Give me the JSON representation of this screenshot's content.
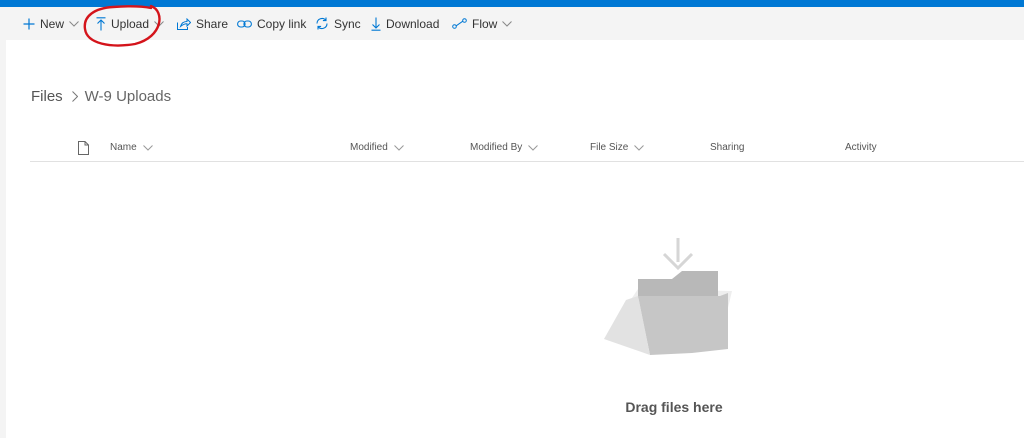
{
  "commandbar": {
    "new_label": "New",
    "upload_label": "Upload",
    "share_label": "Share",
    "copy_link_label": "Copy link",
    "sync_label": "Sync",
    "download_label": "Download",
    "flow_label": "Flow"
  },
  "breadcrumb": {
    "root": "Files",
    "current": "W-9 Uploads"
  },
  "table": {
    "columns": [
      "Name",
      "Modified",
      "Modified By",
      "File Size",
      "Sharing",
      "Activity"
    ]
  },
  "empty_state": {
    "message": "Drag files here"
  },
  "colors": {
    "accent": "#0078d4",
    "annotation": "#d4141b"
  },
  "icons": {
    "new": "plus-icon",
    "upload": "upload-icon",
    "share": "share-icon",
    "copy_link": "link-icon",
    "sync": "sync-icon",
    "download": "download-icon",
    "flow": "flow-icon",
    "file_type": "document-icon"
  }
}
